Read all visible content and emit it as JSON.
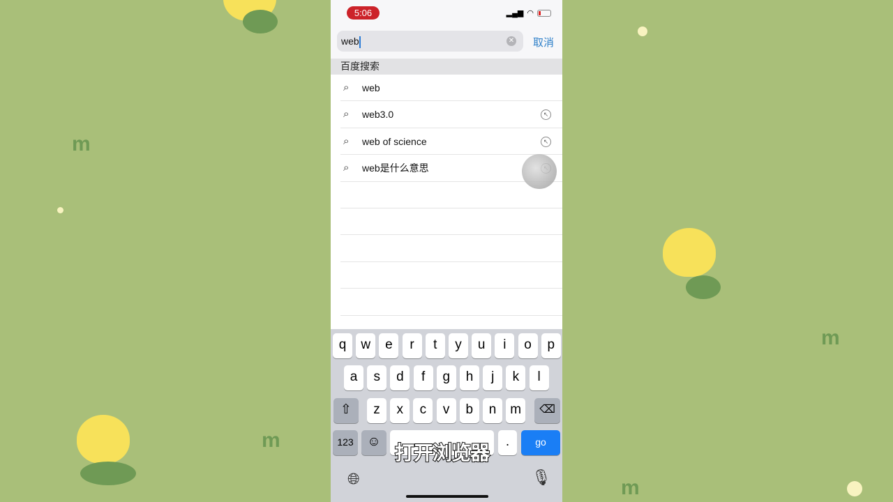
{
  "status": {
    "time": "5:06"
  },
  "search": {
    "value": "web",
    "cancel": "取消"
  },
  "section_title": "百度搜索",
  "suggestions": [
    {
      "text": "web",
      "arrow": false
    },
    {
      "text": "web3.0",
      "arrow": true
    },
    {
      "text": "web of science",
      "arrow": true
    },
    {
      "text": "web是什么意思",
      "arrow": true
    }
  ],
  "keyboard": {
    "row1": [
      "q",
      "w",
      "e",
      "r",
      "t",
      "y",
      "u",
      "i",
      "o",
      "p"
    ],
    "row2": [
      "a",
      "s",
      "d",
      "f",
      "g",
      "h",
      "j",
      "k",
      "l"
    ],
    "row3": [
      "z",
      "x",
      "c",
      "v",
      "b",
      "n",
      "m"
    ],
    "numbers": "123",
    "period": ".",
    "go": "go"
  },
  "subtitle": "打开浏览器",
  "colors": {
    "accent": "#1a7ef5",
    "background": "#a9bf79",
    "status_pill": "#cc2229"
  }
}
